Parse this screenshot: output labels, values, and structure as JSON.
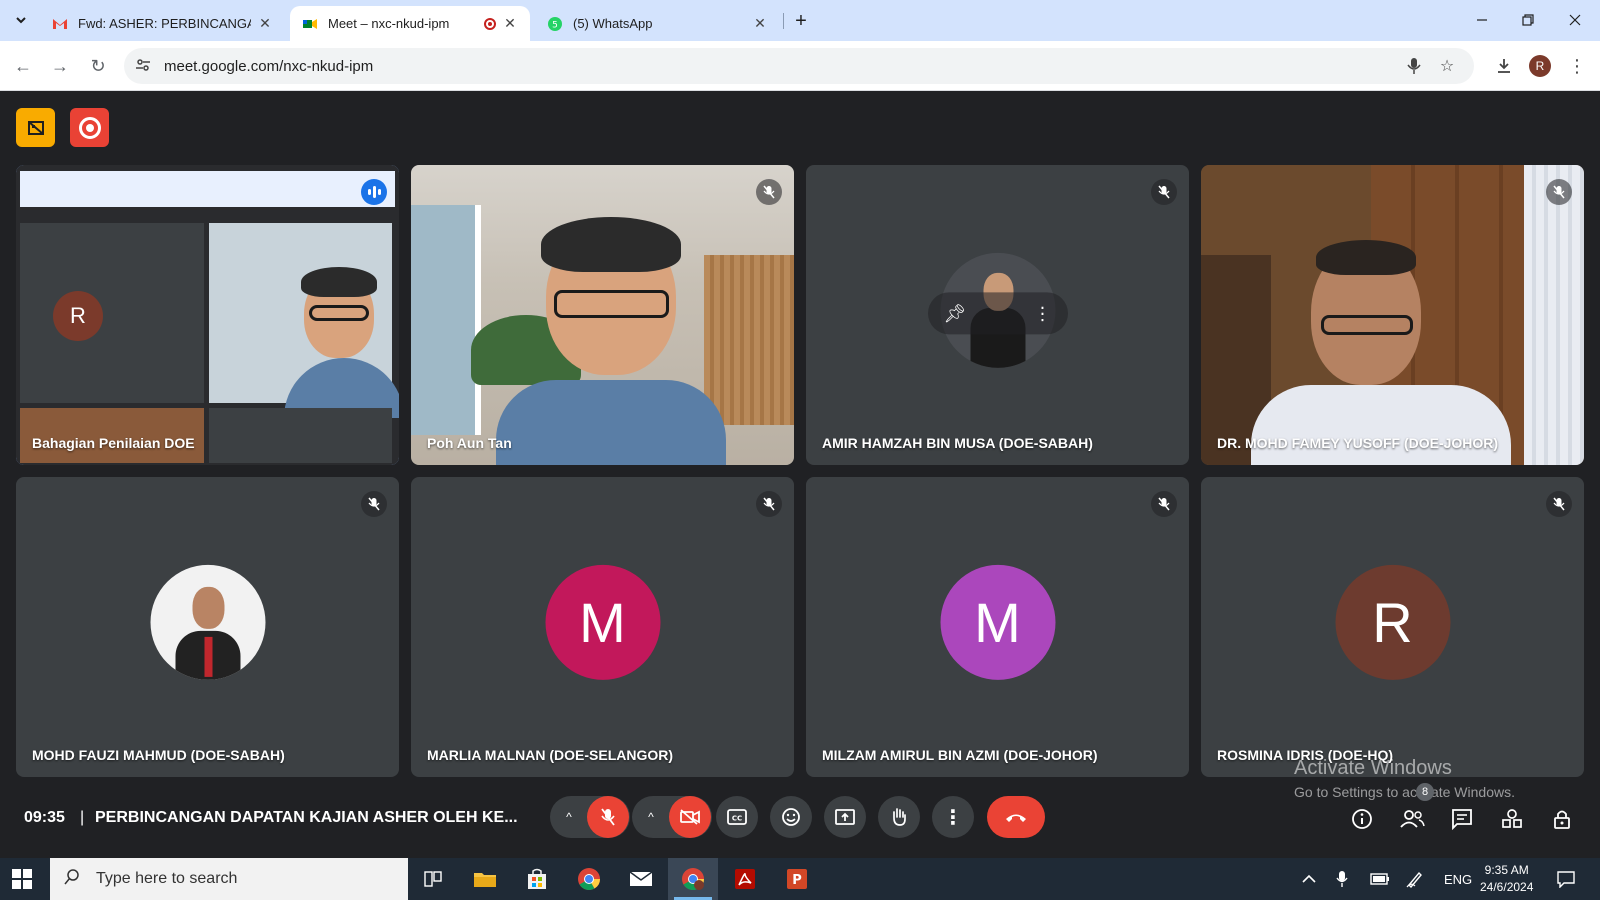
{
  "browser": {
    "tabs": [
      {
        "title": "Fwd: ASHER: PERBINCANGAN D",
        "icon": "gmail-icon"
      },
      {
        "title": "Meet – nxc-nkud-ipm",
        "icon": "meet-icon",
        "recording": true
      },
      {
        "title": "(5) WhatsApp",
        "icon": "whatsapp-icon"
      }
    ],
    "url": "meet.google.com/nxc-nkud-ipm",
    "profile_initial": "R"
  },
  "meet": {
    "participants": [
      {
        "name": "Bahagian Penilaian DOE",
        "type": "screen",
        "speaking": true,
        "inner_initial": "R"
      },
      {
        "name": "Poh Aun Tan",
        "type": "video"
      },
      {
        "name": "AMIR HAMZAH BIN MUSA (DOE-SABAH)",
        "type": "photo"
      },
      {
        "name": "DR. MOHD FAMEY YUSOFF (DOE-JOHOR)",
        "type": "video"
      },
      {
        "name": "MOHD FAUZI MAHMUD (DOE-SABAH)",
        "type": "photo"
      },
      {
        "name": "MARLIA MALNAN (DOE-SELANGOR)",
        "type": "initial",
        "initial": "M",
        "color": "#c2185b"
      },
      {
        "name": "MILZAM AMIRUL BIN AZMI (DOE-JOHOR)",
        "type": "initial",
        "initial": "M",
        "color": "#ab47bc"
      },
      {
        "name": "ROSMINA IDRIS (DOE-HQ)",
        "type": "initial",
        "initial": "R",
        "color": "#6d3b2f"
      }
    ],
    "time": "09:35",
    "separator": "|",
    "title": "PERBINCANGAN DAPATAN KAJIAN ASHER OLEH KE...",
    "people_count": "8",
    "watermark_line1": "Activate Windows",
    "watermark_line2": "Go to Settings to activate Windows."
  },
  "taskbar": {
    "search_placeholder": "Type here to search",
    "language": "ENG",
    "time": "9:35 AM",
    "date": "24/6/2024"
  },
  "colors": {
    "meet_bg": "#202124",
    "tile_bg": "#3c4043",
    "red": "#ea4335",
    "speaking_outline": "#8ab4f8"
  }
}
